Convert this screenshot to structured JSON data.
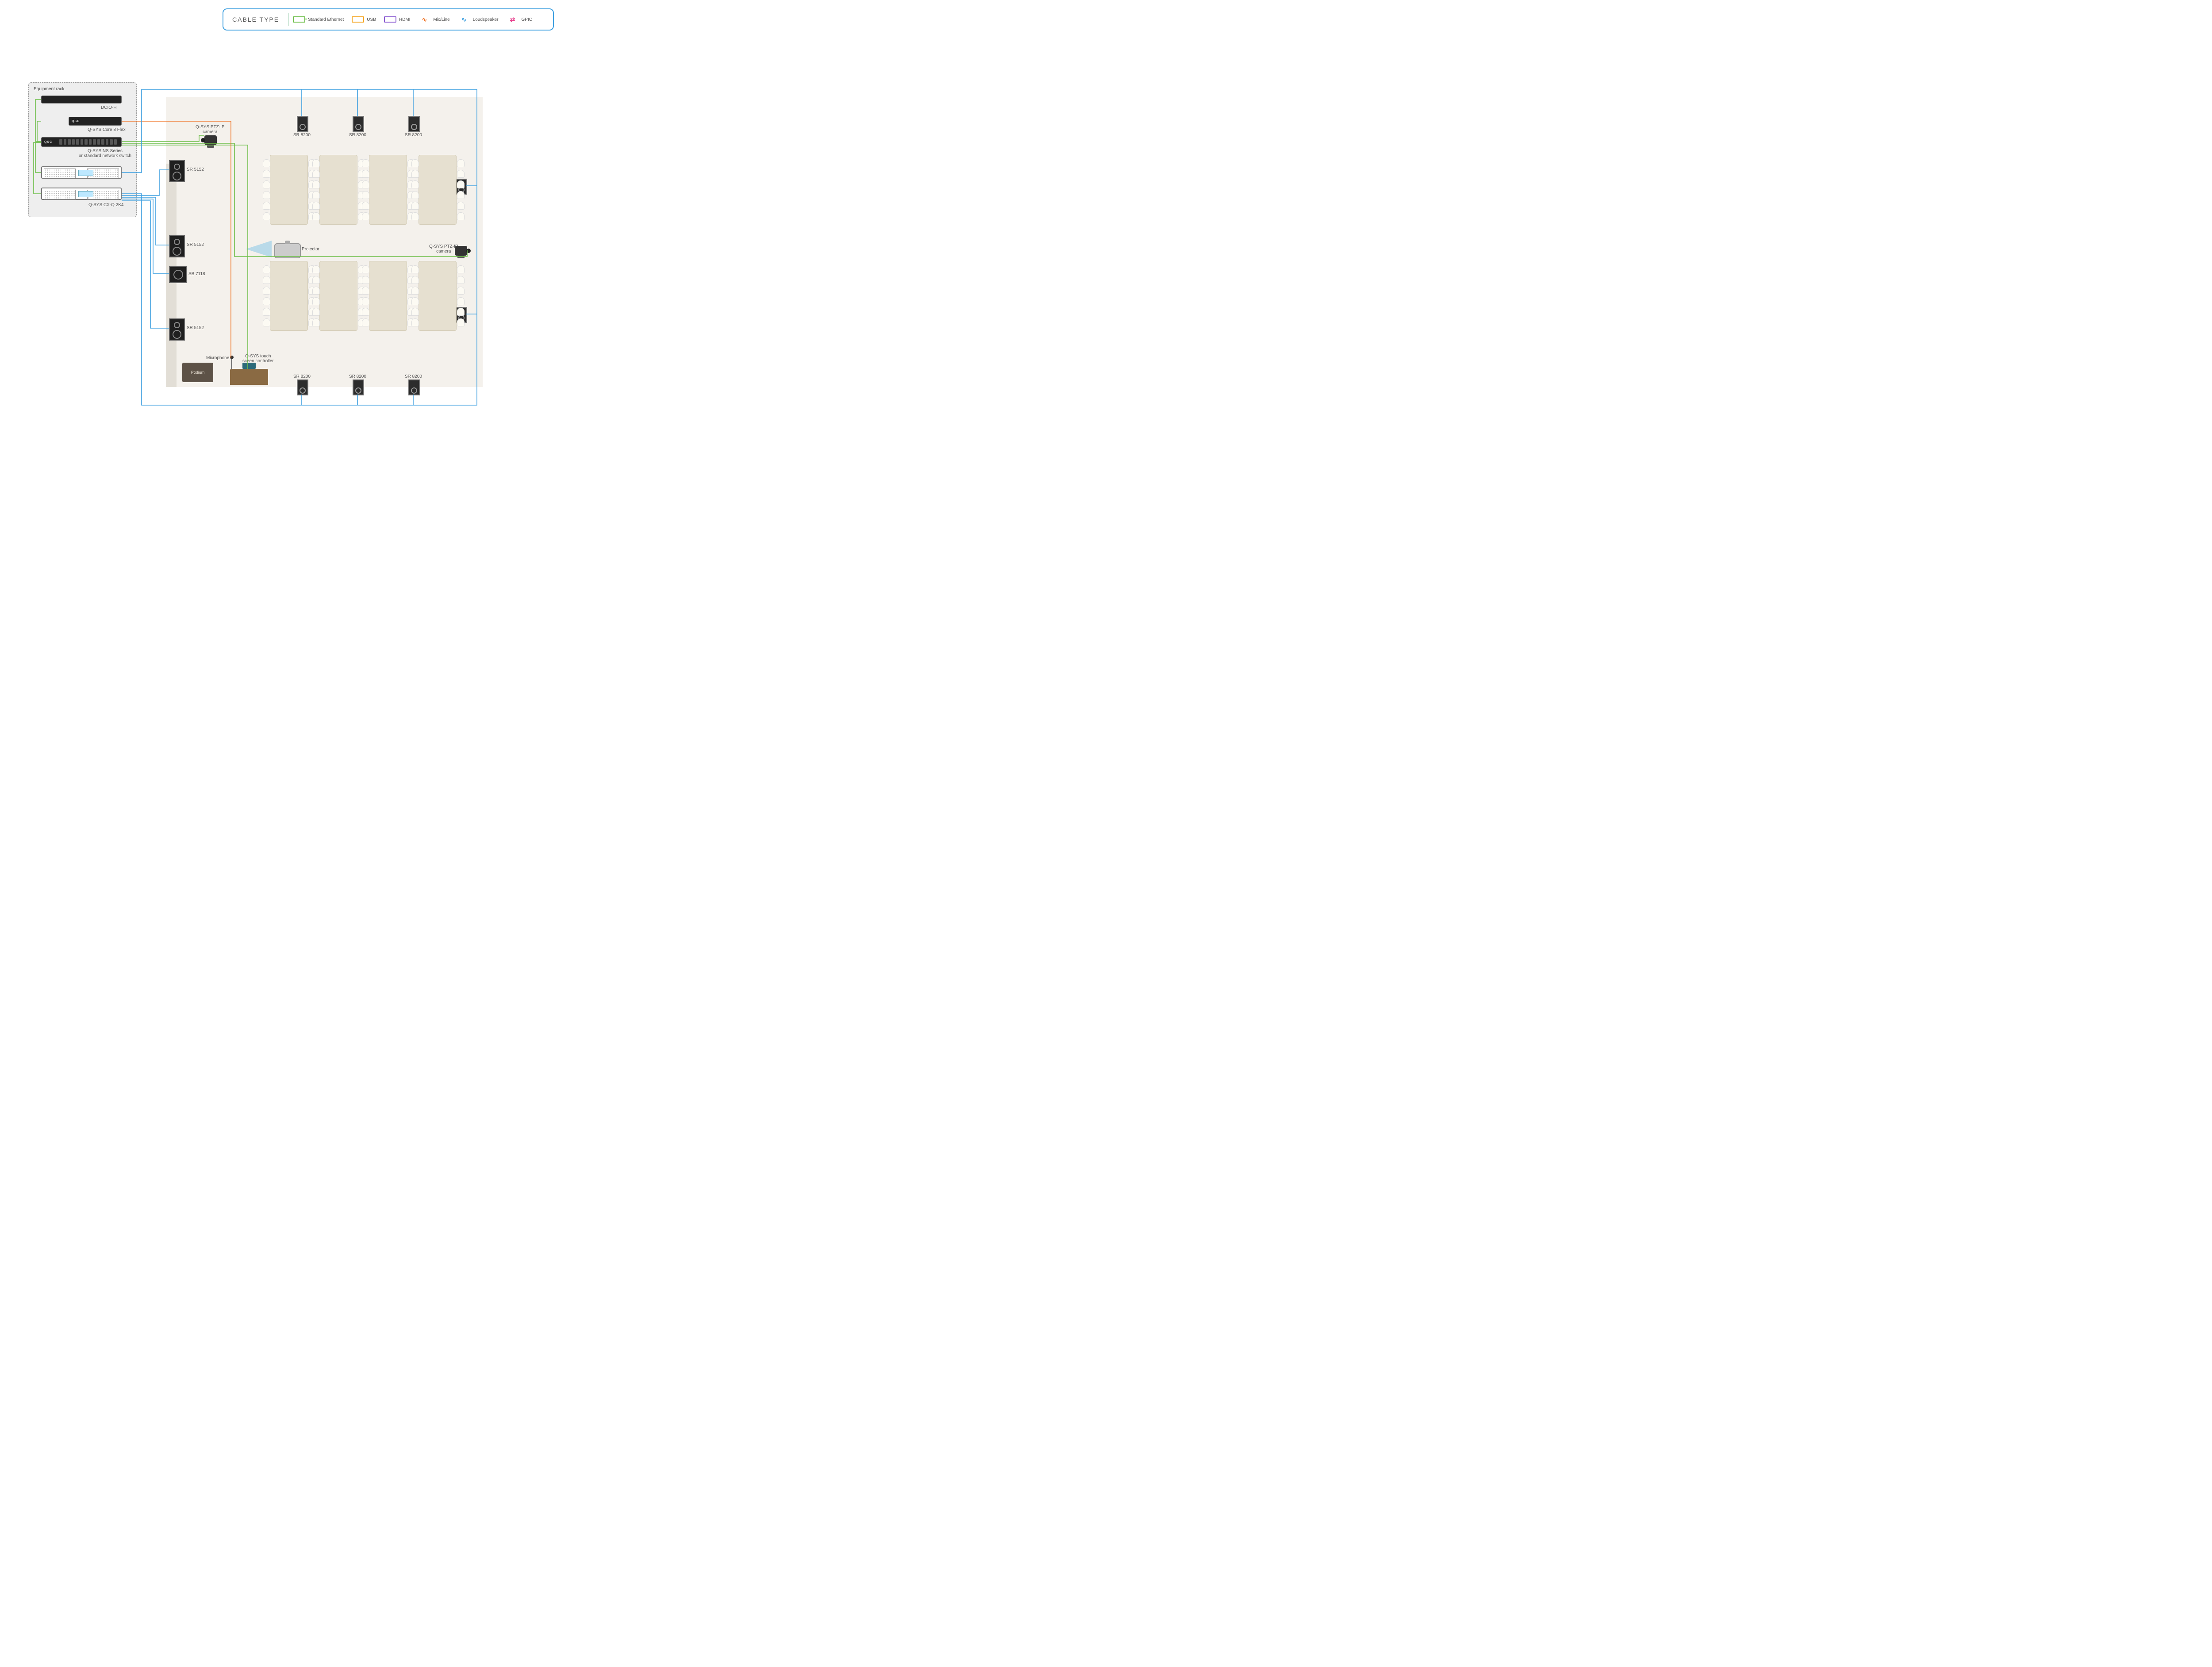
{
  "legend": {
    "title": "CABLE TYPE",
    "ethernet": "Standard Ethernet",
    "usb": "USB",
    "hdmi": "HDMI",
    "mic": "Mic/Line",
    "loudspeaker": "Loudspeaker",
    "gpio": "GPIO"
  },
  "rack": {
    "title": "Equipment rack",
    "dcio": "DCIO-H",
    "core8": "Q-SYS Core 8 Flex",
    "switch": "Q-SYS NS Series\nor standard network switch",
    "amps": "Q-SYS CX-Q 2K4",
    "qsc": "QSC",
    "qsys": "Q-SYS"
  },
  "room": {
    "camera": "Q-SYS PTZ-IP\ncamera",
    "sr5152": "SR 5152",
    "sb7118": "SB 7118",
    "sr8200": "SR 8200",
    "projector": "Projector",
    "microphone": "Microphone",
    "touch_controller": "Q-SYS touch\nsceen controller",
    "podium": "Podium"
  },
  "colors": {
    "ethernet": "#6fbf4b",
    "usb": "#f5a623",
    "hdmi": "#8a5bd1",
    "mic": "#f07020",
    "loudspeaker": "#3fa0e0",
    "gpio": "#e83e8c"
  }
}
